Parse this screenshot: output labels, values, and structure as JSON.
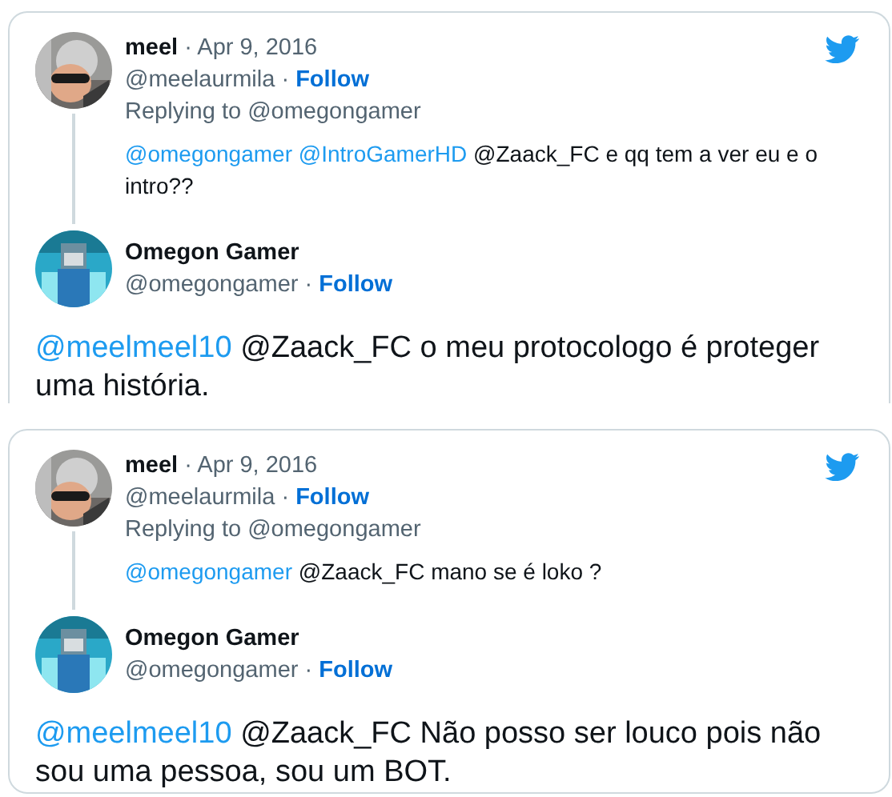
{
  "tweets": [
    {
      "clipped": true,
      "parent": {
        "name": "meel",
        "date": "· Apr 9, 2016",
        "handle": "@meelaurmila ·",
        "follow": "Follow",
        "replying_to": "Replying to @omegongamer",
        "text": [
          {
            "kind": "mention",
            "text": "@omegongamer"
          },
          {
            "kind": "mention",
            "text": "@IntroGamerHD"
          },
          {
            "kind": "plain",
            "text": "@Zaack_FC e qq tem a ver eu e o intro??"
          }
        ]
      },
      "reply": {
        "name": "Omegon Gamer",
        "handle": "@omegongamer ·",
        "follow": "Follow",
        "text": [
          {
            "kind": "mention",
            "text": "@meelmeel10"
          },
          {
            "kind": "plain",
            "text": "@Zaack_FC o meu protocologo é proteger uma história."
          }
        ]
      }
    },
    {
      "clipped": false,
      "parent": {
        "name": "meel",
        "date": "· Apr 9, 2016",
        "handle": "@meelaurmila ·",
        "follow": "Follow",
        "replying_to": "Replying to @omegongamer",
        "text": [
          {
            "kind": "mention",
            "text": "@omegongamer"
          },
          {
            "kind": "plain",
            "text": "@Zaack_FC mano se é loko ?"
          }
        ]
      },
      "reply": {
        "name": "Omegon Gamer",
        "handle": "@omegongamer ·",
        "follow": "Follow",
        "text": [
          {
            "kind": "mention",
            "text": "@meelmeel10"
          },
          {
            "kind": "plain",
            "text": "@Zaack_FC Não posso ser louco pois não sou uma pessoa, sou um BOT."
          }
        ]
      }
    }
  ]
}
